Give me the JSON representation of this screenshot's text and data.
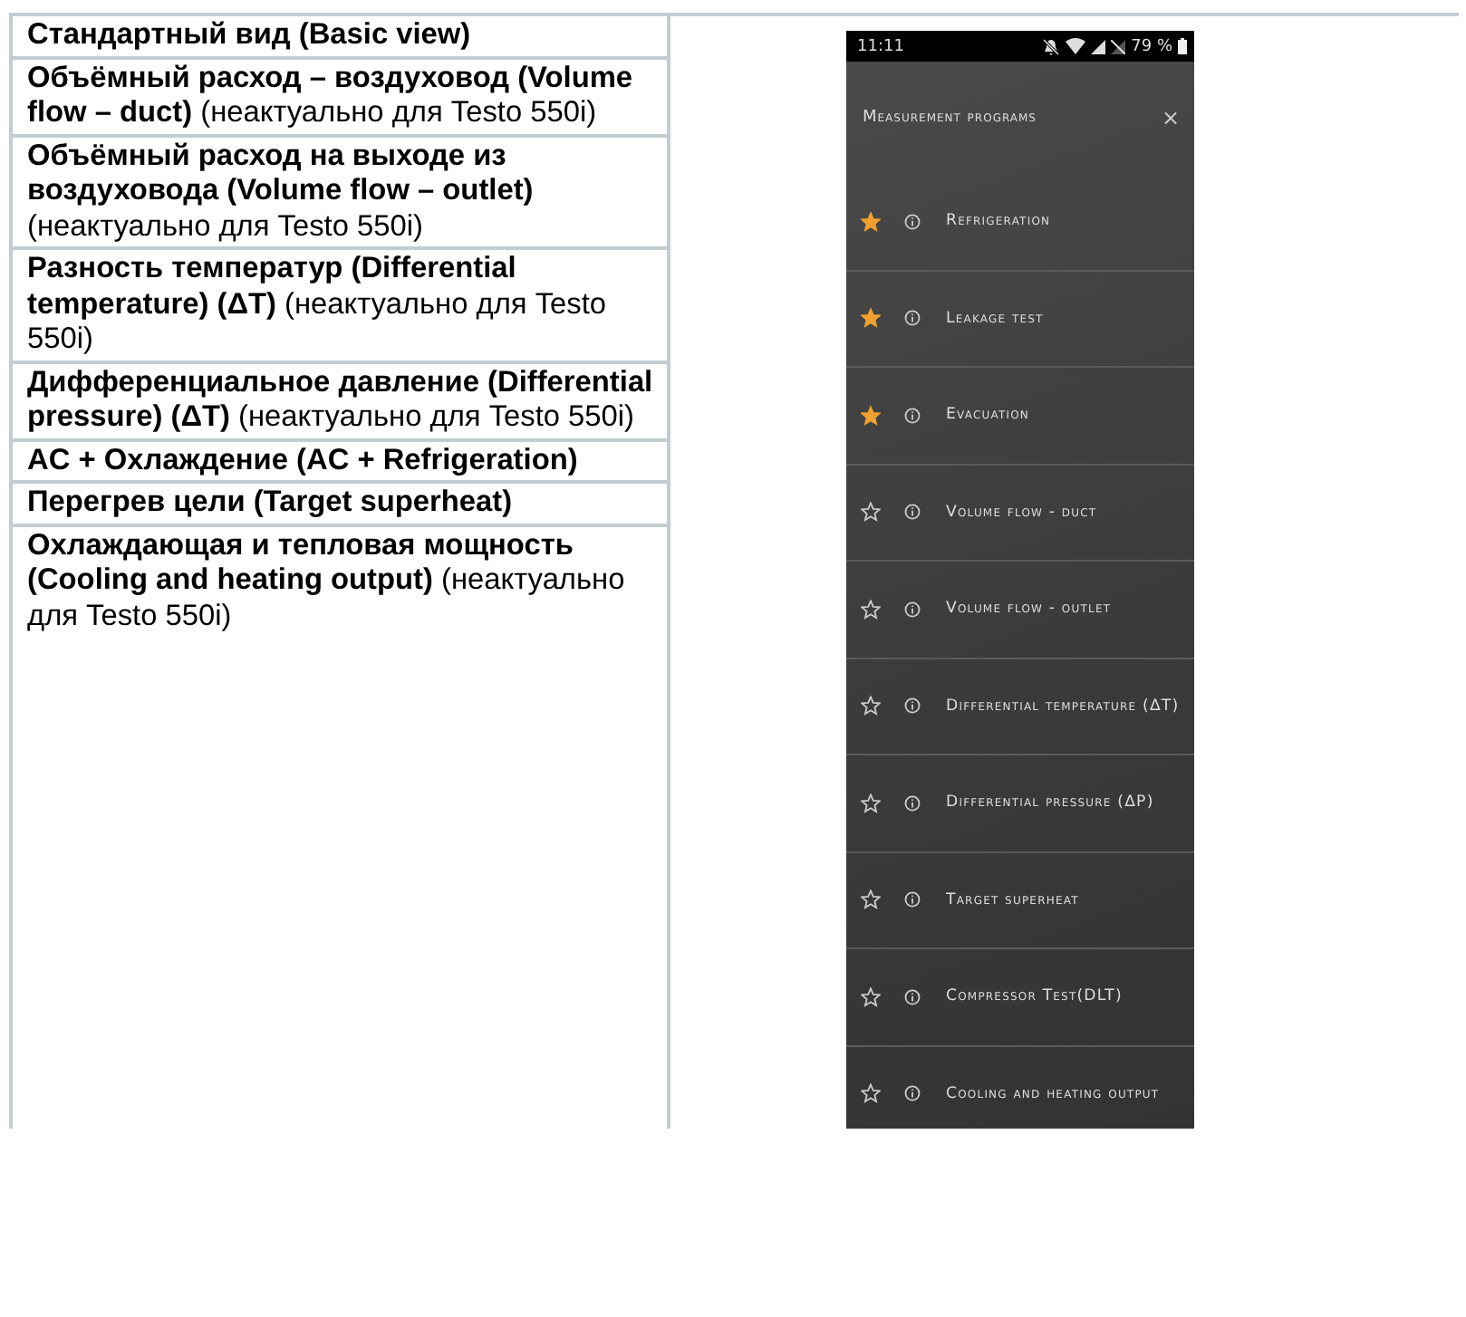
{
  "table": {
    "rows": [
      {
        "text": "**Стандартный вид (Basic view)**"
      },
      {
        "text": "**Объёмный расход – воздуховод (Volume flow – duct)** (неактуально для Testo 550i)"
      },
      {
        "text": "**Объёмный расход на выходе из воздуховода (Volume flow – outlet)** (неактуально для Testo 550i)"
      },
      {
        "text": "**Разность температур (Differential temperature) (ΔT)** (неактуально для Testo 550i)"
      },
      {
        "text": "**Дифференциальное давление (Differential pressure) (ΔT)** (неактуально для Testo 550i)"
      },
      {
        "text": "**AC + Охлаждение (AC + Refrigeration)**"
      },
      {
        "text": "**Перегрев цели (Target superheat)**"
      },
      {
        "text": "**Охлаждающая и тепловая мощность (Cooling and heating output)** (неактуально для Testo 550i)"
      }
    ]
  },
  "phone": {
    "status_bar": {
      "time": "11:11",
      "battery": "79 %"
    },
    "header": {
      "title": "Measurement programs",
      "close": "×"
    },
    "programs": [
      {
        "label": "Refrigeration",
        "favorite": true
      },
      {
        "label": "Leakage test",
        "favorite": true
      },
      {
        "label": "Evacuation",
        "favorite": true
      },
      {
        "label": "Volume flow - duct",
        "favorite": false
      },
      {
        "label": "Volume flow - outlet",
        "favorite": false
      },
      {
        "label": "Differential temperature (ΔT)",
        "favorite": false
      },
      {
        "label": "Differential pressure (ΔP)",
        "favorite": false
      },
      {
        "label": "Target superheat",
        "favorite": false
      },
      {
        "label": "Compressor Test(DLT)",
        "favorite": false
      },
      {
        "label": "Cooling and heating output",
        "favorite": false
      }
    ]
  }
}
